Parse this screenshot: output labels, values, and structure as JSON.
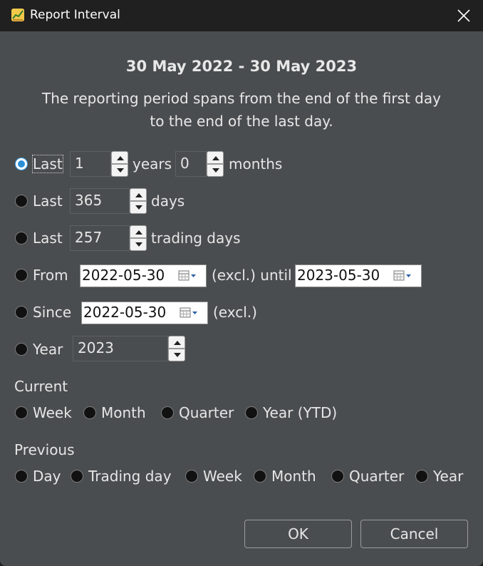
{
  "window": {
    "title": "Report Interval"
  },
  "header": {
    "period": "30 May 2022 - 30 May 2023",
    "description_line1": "The reporting period spans from the end of the first day",
    "description_line2": "to the end of the last day."
  },
  "options": {
    "last_years": {
      "label": "Last",
      "years_value": "1",
      "years_unit": "years",
      "months_value": "0",
      "months_unit": "months",
      "selected": true
    },
    "last_days": {
      "label": "Last",
      "value": "365",
      "unit": "days"
    },
    "last_trading_days": {
      "label": "Last",
      "value": "257",
      "unit": "trading days"
    },
    "from_until": {
      "label": "From",
      "from_date": "2022-05-30",
      "excl_until": "(excl.) until",
      "until_date": "2023-05-30"
    },
    "since": {
      "label": "Since",
      "date": "2022-05-30",
      "excl": "(excl.)"
    },
    "year": {
      "label": "Year",
      "value": "2023"
    }
  },
  "current": {
    "heading": "Current",
    "items": [
      "Week",
      "Month",
      "Quarter",
      "Year (YTD)"
    ]
  },
  "previous": {
    "heading": "Previous",
    "items": [
      "Day",
      "Trading day",
      "Week",
      "Month",
      "Quarter",
      "Year"
    ]
  },
  "buttons": {
    "ok": "OK",
    "cancel": "Cancel"
  },
  "icons": {
    "app": "app-chart-icon",
    "close": "close-icon",
    "calendar": "calendar-dropdown-icon"
  },
  "colors": {
    "background": "#4a4d4f",
    "titlebar": "#202020",
    "radio_selected": "#2b8fd8"
  }
}
